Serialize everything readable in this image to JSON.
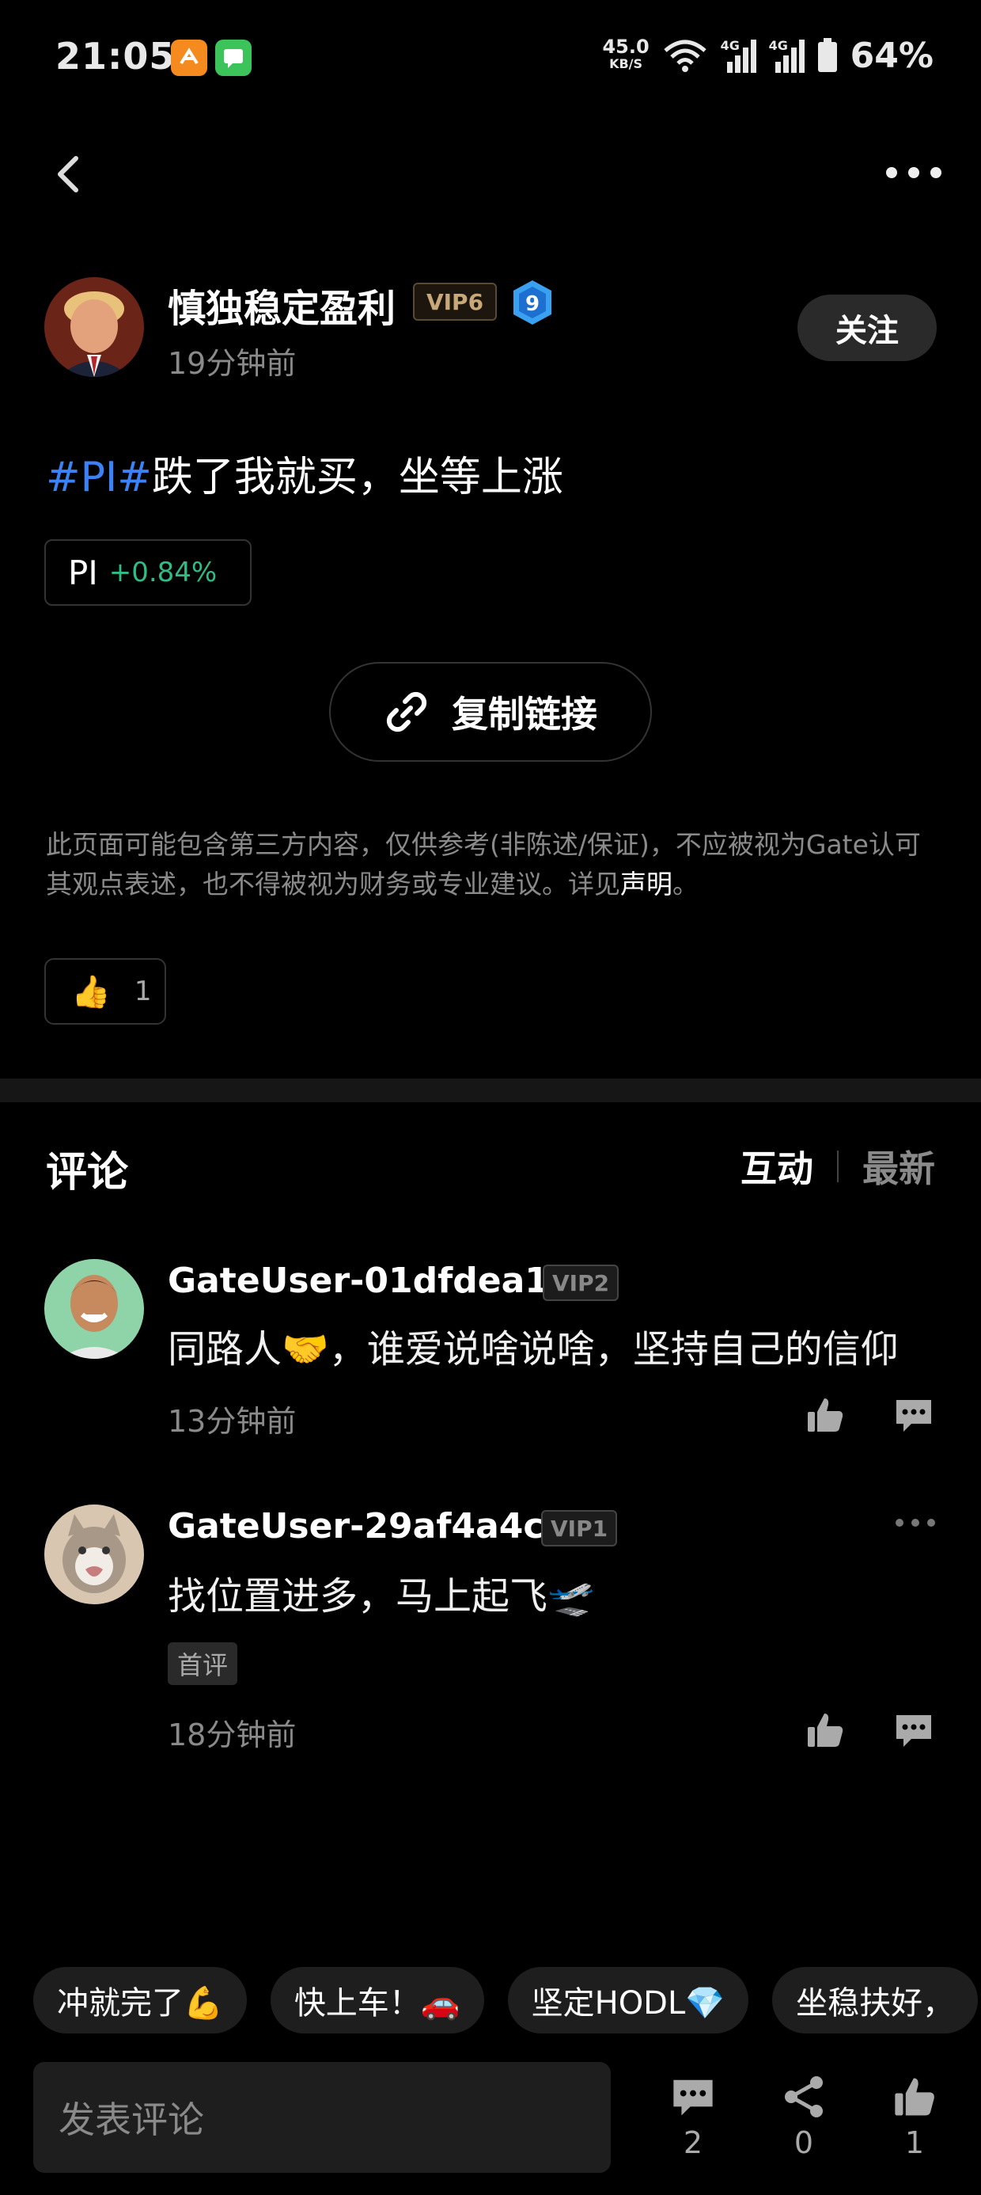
{
  "status_bar": {
    "time": "21:05",
    "net_speed": "45.0",
    "net_unit": "KB/S",
    "signal1_label": "4G",
    "signal2_label": "4G",
    "battery": "64%"
  },
  "author": {
    "name": "慎独稳定盈利",
    "vip": "VIP6",
    "level": "9",
    "time": "19分钟前",
    "follow_label": "关注"
  },
  "post": {
    "tag": "#PI#",
    "text": "跌了我就买，坐等上涨",
    "coin": {
      "name": "PI",
      "change": "+0.84%"
    },
    "copy_link_label": "复制链接",
    "disclaimer": "此页面可能包含第三方内容，仅供参考(非陈述/保证)，不应被视为Gate认可其观点表述，也不得被视为财务或专业建议。详见",
    "disclaimer_link": "声明",
    "disclaimer_end": "。",
    "like_count": "1"
  },
  "comments": {
    "title": "评论",
    "sort_tabs": [
      "互动",
      "最新"
    ],
    "items": [
      {
        "user": "GateUser-01dfdea1",
        "vip": "VIP2",
        "text": "同路人🤝，谁爱说啥说啥，坚持自己的信仰",
        "time": "13分钟前"
      },
      {
        "user": "GateUser-29af4a4c",
        "vip": "VIP1",
        "text": "找位置进多，马上起飞🛫",
        "tag": "首评",
        "time": "18分钟前"
      }
    ]
  },
  "quick_replies": [
    "冲就完了💪",
    "快上车！🚗",
    "坚定HODL💎",
    "坐稳扶好，"
  ],
  "bottom_bar": {
    "input_placeholder": "发表评论",
    "comment_count": "2",
    "share_count": "0",
    "like_count": "1"
  },
  "colors": {
    "accent_tag": "#3b82f6",
    "positive": "#2ebd85",
    "vip_gold": "#c8a878",
    "background": "#000000"
  }
}
